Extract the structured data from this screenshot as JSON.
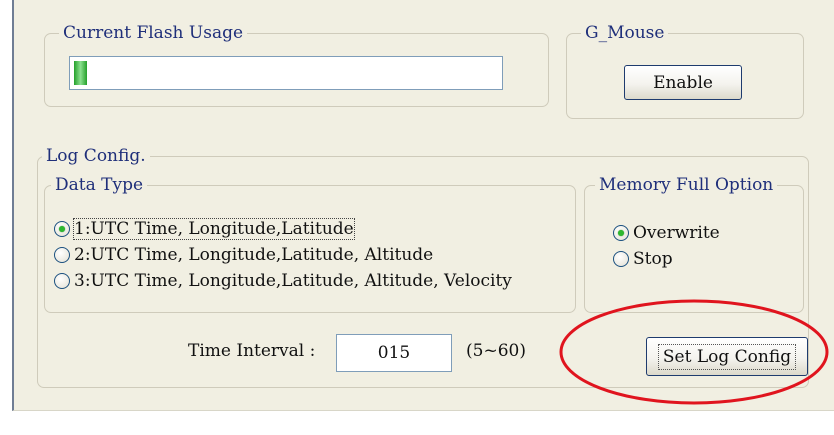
{
  "flash_usage": {
    "title": "Current Flash Usage",
    "progress_fraction": 0.03
  },
  "g_mouse": {
    "title": "G_Mouse",
    "button_label": "Enable"
  },
  "log_config": {
    "title": "Log Config.",
    "data_type": {
      "title": "Data Type",
      "options": [
        "1:UTC Time, Longitude,Latitude",
        "2:UTC Time, Longitude,Latitude, Altitude",
        "3:UTC Time, Longitude,Latitude, Altitude, Velocity"
      ],
      "selected_index": 0
    },
    "memory_full": {
      "title": "Memory Full Option",
      "options": [
        "Overwrite",
        "Stop"
      ],
      "selected_index": 0
    },
    "time_interval": {
      "label": "Time Interval :",
      "value": "015",
      "range": "(5~60)"
    },
    "set_button_label": "Set Log Config"
  },
  "colors": {
    "panel_background": "#f1efe2",
    "legend_text": "#1f2f7a",
    "radio_dot": "#2db82f",
    "progress_fill": "#24a02a",
    "annotation_circle": "#e0141e"
  }
}
